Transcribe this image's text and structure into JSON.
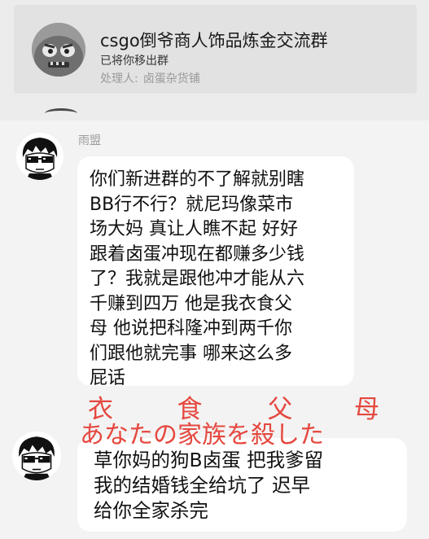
{
  "notice": {
    "title": "csgo倒爷商人饰品炼金交流群",
    "subtitle": "已将你移出群",
    "handler_label": "处理人:",
    "handler_name": "卤蛋杂货铺"
  },
  "messages": [
    {
      "sender": "雨盟",
      "lines": [
        "你们新进群的不了解就别瞎",
        "BB行不行？就尼玛像菜市",
        "场大妈 真让人瞧不起 好好",
        "跟着卤蛋冲现在都赚多少钱",
        "了？我就是跟他冲才能从六",
        "千赚到四万 他是我衣食父",
        "母 他说把科隆冲到两千你",
        "们跟他就完事 哪来这么多",
        "屁话"
      ]
    },
    {
      "sender": "",
      "lines": [
        "草你妈的狗B卤蛋 把我爹留",
        "我的结婚钱全给坑了 迟早",
        "给你全家杀完"
      ]
    }
  ],
  "overlay": {
    "line1": [
      "衣",
      "食",
      "父",
      "母"
    ],
    "line2": "あなたの家族を殺した"
  },
  "colors": {
    "overlay_red": "#e5483f",
    "notice_bg": "#e2e2e2",
    "panel_bg": "#f3f3f3"
  },
  "icons": {
    "group_avatar": "zombie-avatar-icon",
    "user_avatar": "cartoon-sunglasses-avatar-icon"
  }
}
